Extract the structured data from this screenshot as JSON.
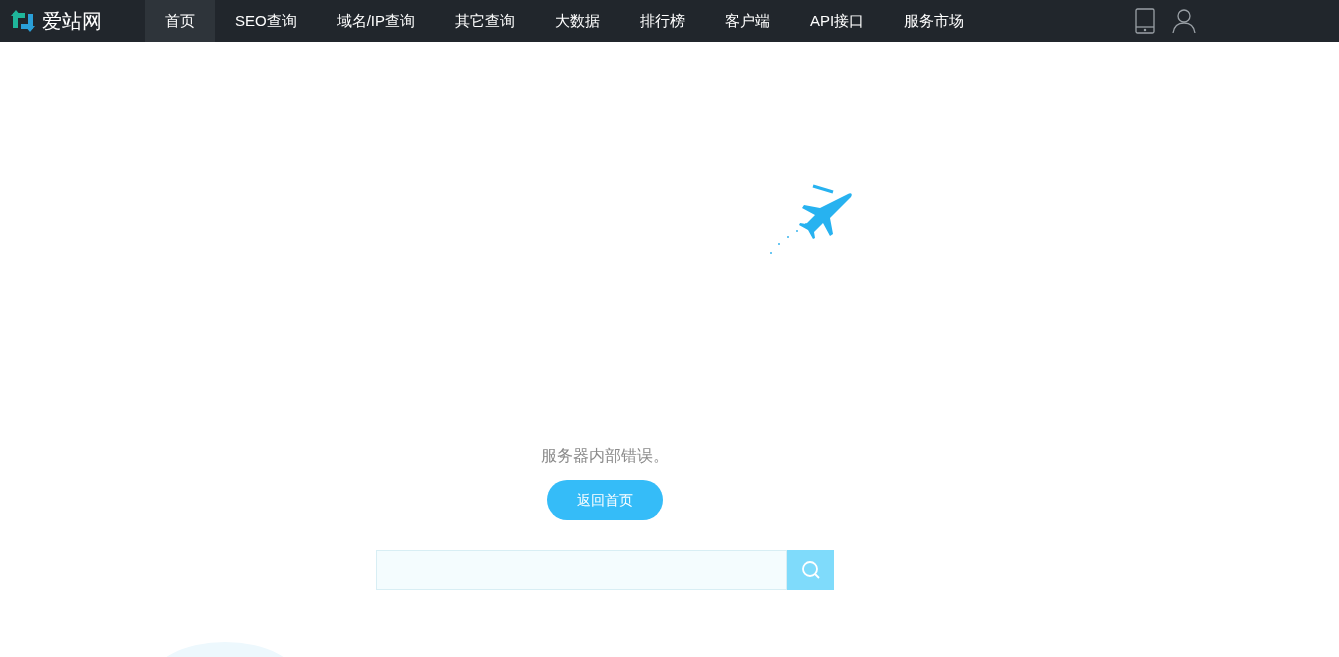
{
  "navbar": {
    "logo_text": "爱站网",
    "items": [
      {
        "label": "首页",
        "selected": true
      },
      {
        "label": "SEO查询",
        "selected": false
      },
      {
        "label": "域名/IP查询",
        "selected": false
      },
      {
        "label": "其它查询",
        "selected": false
      },
      {
        "label": "大数据",
        "selected": false
      },
      {
        "label": "排行榜",
        "selected": false
      },
      {
        "label": "客户端",
        "selected": false
      },
      {
        "label": "API接口",
        "selected": false
      },
      {
        "label": "服务市场",
        "selected": false
      }
    ]
  },
  "error": {
    "message": "服务器内部错误。",
    "button": "返回首页"
  }
}
